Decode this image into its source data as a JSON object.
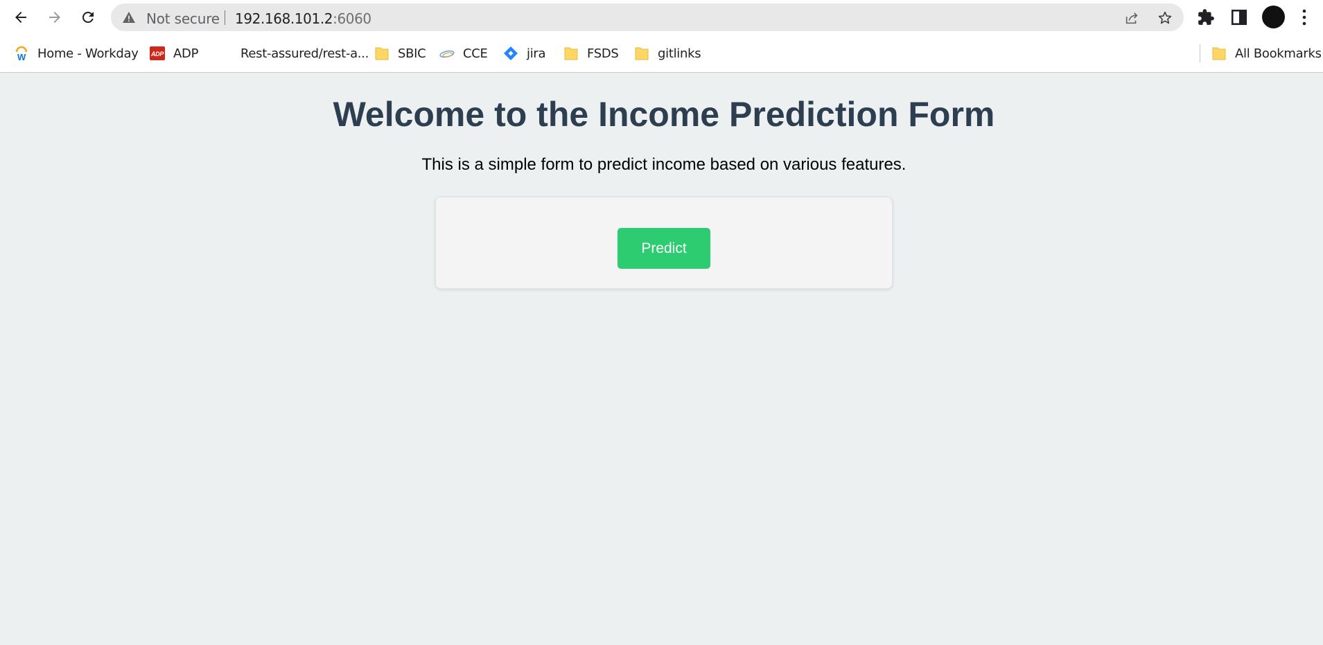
{
  "browser": {
    "security_label": "Not secure",
    "url_host": "192.168.101.2",
    "url_port": ":6060",
    "icons": [
      "back-icon",
      "forward-icon",
      "reload-icon",
      "warning-icon",
      "share-icon",
      "star-icon",
      "extensions-icon",
      "side-panel-icon",
      "profile-avatar",
      "menu-icon"
    ]
  },
  "bookmarks": {
    "items": [
      {
        "label": "Home - Workday",
        "icon": "workday-icon"
      },
      {
        "label": "ADP",
        "icon": "adp-icon"
      },
      {
        "label": "Rest-assured/rest-a...",
        "icon": "github-icon"
      },
      {
        "label": "SBIC",
        "icon": "folder-icon"
      },
      {
        "label": "CCE",
        "icon": "cce-icon"
      },
      {
        "label": "jira",
        "icon": "jira-icon"
      },
      {
        "label": "FSDS",
        "icon": "folder-icon"
      },
      {
        "label": "gitlinks",
        "icon": "folder-icon"
      }
    ],
    "all_bookmarks_label": "All Bookmarks"
  },
  "page": {
    "title": "Welcome to the Income Prediction Form",
    "description": "This is a simple form to predict income based on various features.",
    "predict_button_label": "Predict",
    "colors": {
      "background": "#ecf0f1",
      "title": "#2c3e50",
      "button": "#2ecc71"
    }
  }
}
